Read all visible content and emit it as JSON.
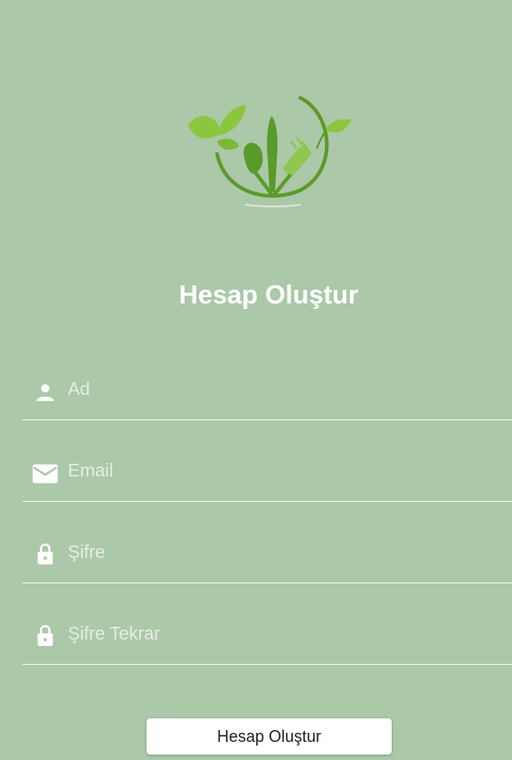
{
  "colors": {
    "background": "#abc8a8",
    "leaf_light": "#8cc63f",
    "leaf_dark": "#5a9a2a",
    "text": "#ffffff",
    "divider": "#f2f6f1"
  },
  "logo": {
    "icon": "leaf-cutlery-logo"
  },
  "title": "Hesap Oluştur",
  "fields": [
    {
      "icon": "person-icon",
      "placeholder": "Ad",
      "value": ""
    },
    {
      "icon": "mail-icon",
      "placeholder": "Email",
      "value": ""
    },
    {
      "icon": "lock-icon",
      "placeholder": "Şifre",
      "value": ""
    },
    {
      "icon": "lock-icon",
      "placeholder": "Şifre Tekrar",
      "value": ""
    }
  ],
  "submit_label": "Hesap Oluştur"
}
